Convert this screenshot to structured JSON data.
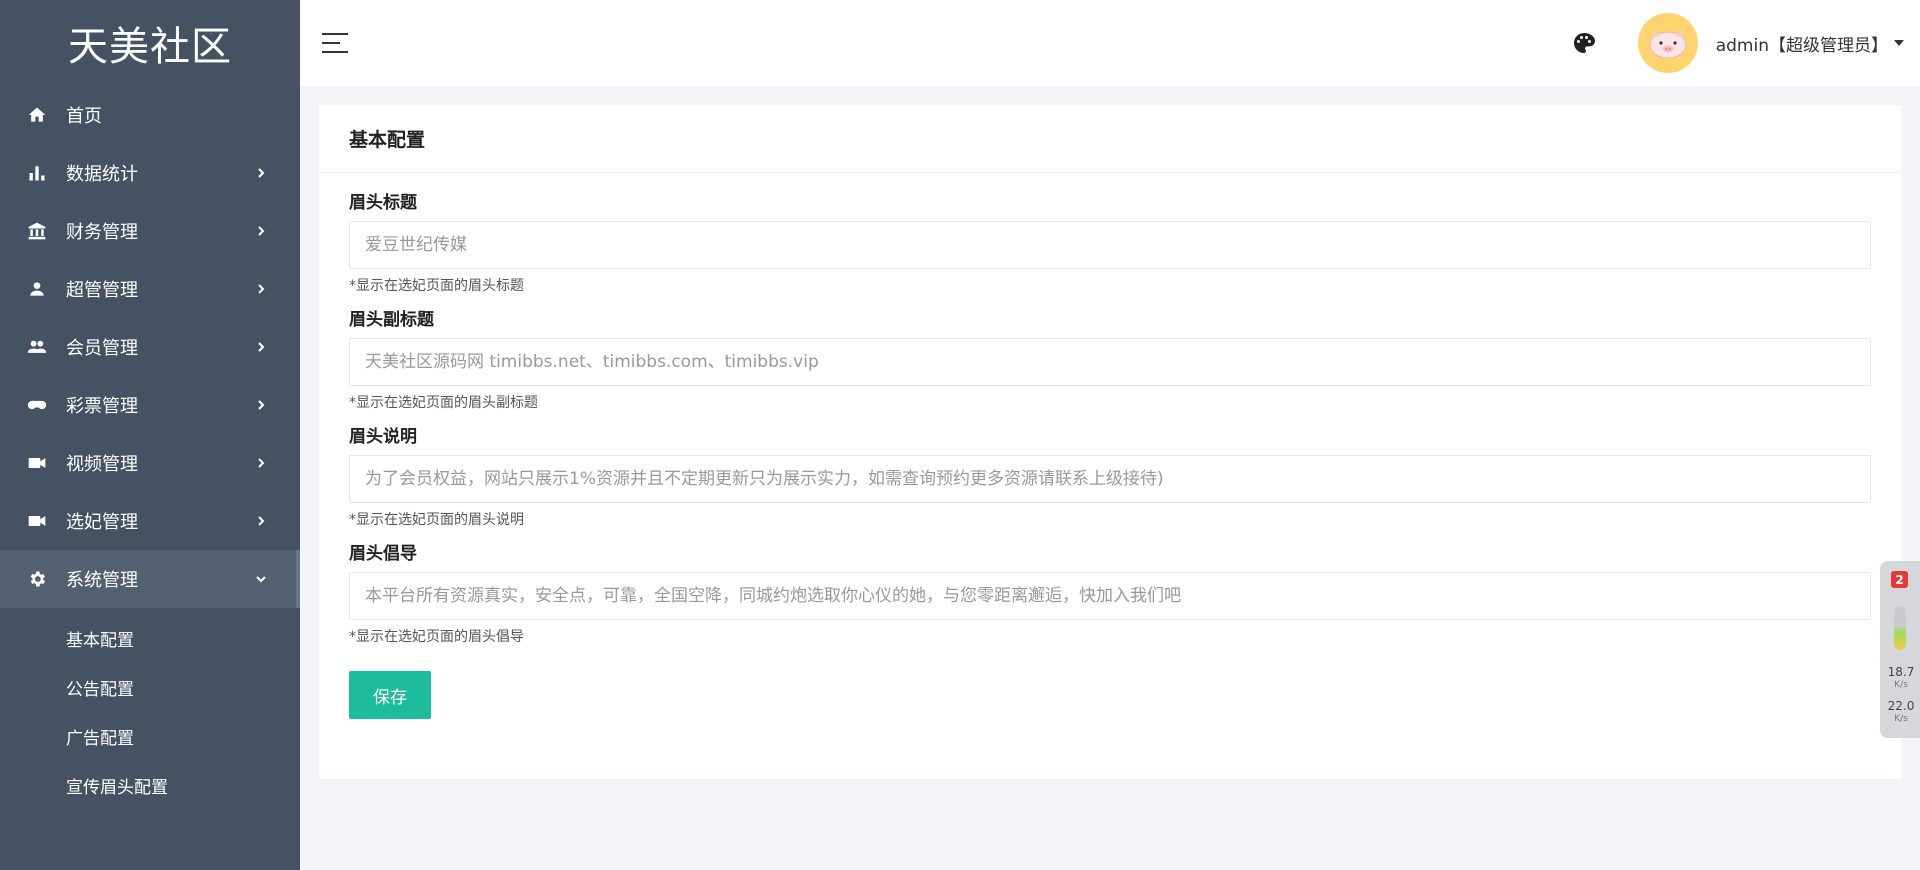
{
  "brand": "天美社区",
  "nav": {
    "items": [
      {
        "label": "首页",
        "icon": "home-icon"
      },
      {
        "label": "数据统计",
        "icon": "bar-chart-icon"
      },
      {
        "label": "财务管理",
        "icon": "bank-icon"
      },
      {
        "label": "超管管理",
        "icon": "person-icon"
      },
      {
        "label": "会员管理",
        "icon": "people-icon"
      },
      {
        "label": "彩票管理",
        "icon": "gamepad-icon"
      },
      {
        "label": "视频管理",
        "icon": "video-camera-icon"
      },
      {
        "label": "选妃管理",
        "icon": "video-camera-icon"
      },
      {
        "label": "系统管理",
        "icon": "gear-icon"
      }
    ],
    "sub_items": [
      "基本配置",
      "公告配置",
      "广告配置",
      "宣传眉头配置"
    ]
  },
  "header": {
    "user": "admin【超级管理员】"
  },
  "card": {
    "title": "基本配置",
    "fields": [
      {
        "label": "眉头标题",
        "placeholder": "爱豆世纪传媒",
        "help": "*显示在选妃页面的眉头标题"
      },
      {
        "label": "眉头副标题",
        "placeholder": "天美社区源码网 timibbs.net、timibbs.com、timibbs.vip",
        "help": "*显示在选妃页面的眉头副标题"
      },
      {
        "label": "眉头说明",
        "placeholder": "为了会员权益，网站只展示1%资源并且不定期更新只为展示实力，如需查询预约更多资源请联系上级接待)",
        "help": "*显示在选妃页面的眉头说明"
      },
      {
        "label": "眉头倡导",
        "placeholder": "本平台所有资源真实，安全点，可靠，全国空降，同城约炮选取你心仪的她，与您零距离邂逅，快加入我们吧",
        "help": "*显示在选妃页面的眉头倡导"
      }
    ],
    "save_label": "保存"
  },
  "widget": {
    "badge": "2",
    "up_value": "18.7",
    "up_unit": "K/s",
    "down_value": "22.0",
    "down_unit": "K/s"
  },
  "colors": {
    "sidebar_bg": "#465264",
    "accent": "#1ebc9f",
    "page_bg": "#f3f4f8"
  }
}
